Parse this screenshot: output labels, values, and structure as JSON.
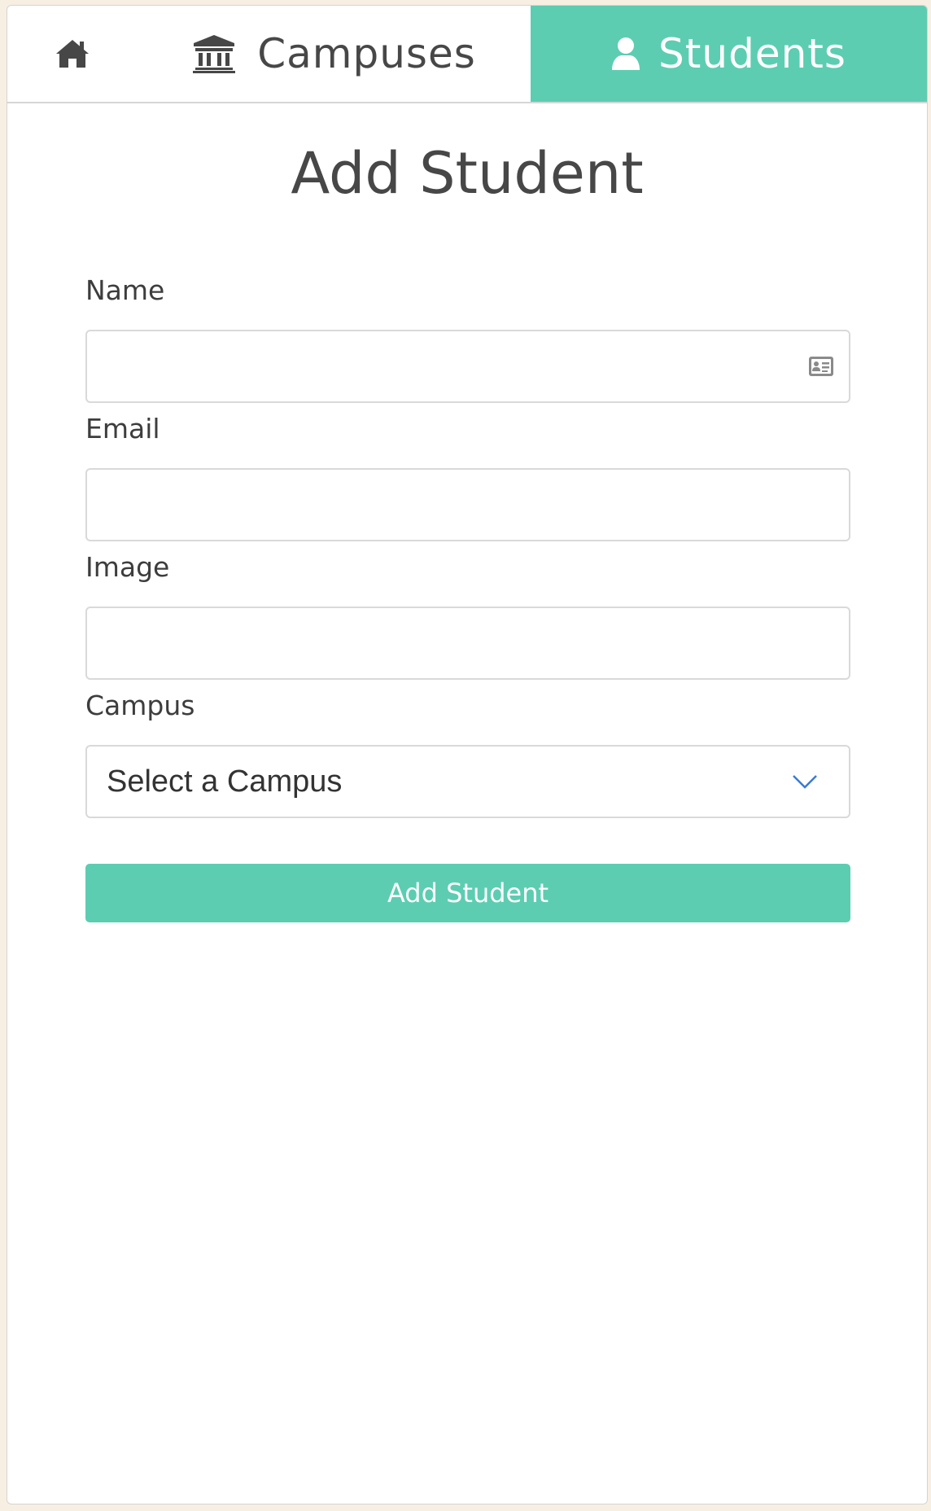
{
  "nav": {
    "home_icon": "home-icon",
    "campuses": {
      "label": "Campuses",
      "icon": "bank-icon"
    },
    "students": {
      "label": "Students",
      "icon": "user-icon",
      "active": true
    }
  },
  "page": {
    "title": "Add Student"
  },
  "form": {
    "name": {
      "label": "Name",
      "value": "",
      "icon": "id-card-icon"
    },
    "email": {
      "label": "Email",
      "value": ""
    },
    "image": {
      "label": "Image",
      "value": ""
    },
    "campus": {
      "label": "Campus",
      "selected": "Select a Campus",
      "icon": "chevron-down-icon"
    },
    "submit_label": "Add Student"
  },
  "colors": {
    "accent": "#5dcdb2",
    "text": "#474747",
    "page_background": "#f8efe3",
    "chevron": "#3a7bd5"
  }
}
